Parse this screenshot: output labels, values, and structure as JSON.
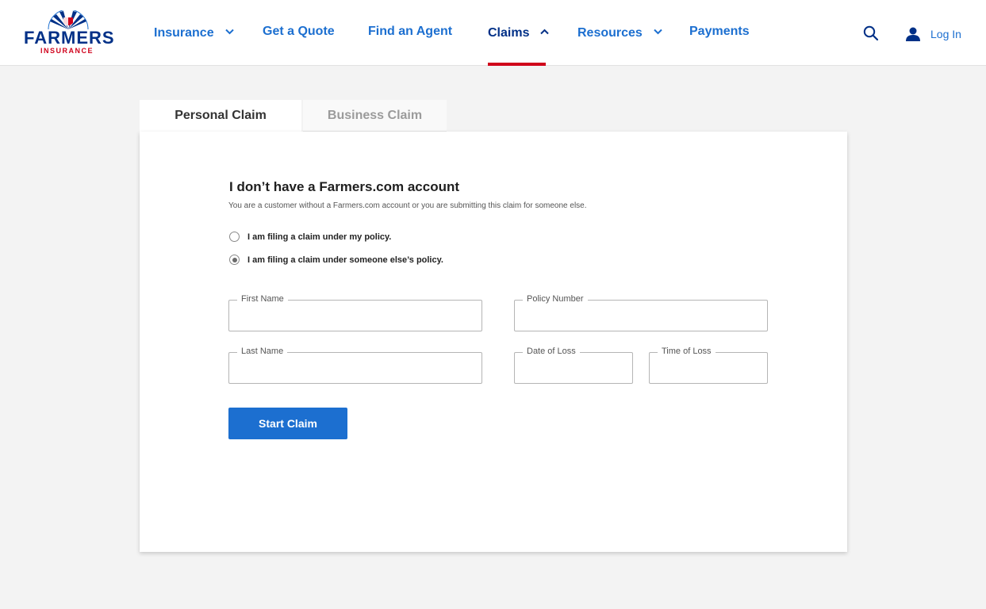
{
  "brand": {
    "logo_word": "FARMERS",
    "logo_sub": "INSURANCE",
    "primary_color": "#003087",
    "accent_red": "#d0021b",
    "link_blue": "#1c6fd0"
  },
  "nav": {
    "items": [
      {
        "label": "Insurance",
        "has_dropdown": true,
        "expanded": false
      },
      {
        "label": "Get a Quote",
        "has_dropdown": false
      },
      {
        "label": "Find an Agent",
        "has_dropdown": false
      },
      {
        "label": "Claims",
        "has_dropdown": true,
        "expanded": true,
        "active": true
      },
      {
        "label": "Resources",
        "has_dropdown": true,
        "expanded": false
      },
      {
        "label": "Payments",
        "has_dropdown": false
      }
    ],
    "search_icon": "search-icon",
    "login_icon": "user-icon",
    "login_label": "Log In"
  },
  "tabs": [
    {
      "label": "Personal Claim",
      "selected": true
    },
    {
      "label": "Business Claim",
      "selected": false
    }
  ],
  "form": {
    "title": "I don’t have a Farmers.com account",
    "subtitle": "You are a customer without a Farmers.com account or you are submitting this claim for someone else.",
    "options": [
      {
        "label": "I am filing a claim under my policy.",
        "checked": false
      },
      {
        "label": "I am filing a claim under someone else’s policy.",
        "checked": true
      }
    ],
    "fields": {
      "first_name": {
        "label": "First Name",
        "value": ""
      },
      "policy_number": {
        "label": "Policy Number",
        "value": ""
      },
      "last_name": {
        "label": "Last Name",
        "value": ""
      },
      "date_of_loss": {
        "label": "Date of Loss",
        "value": ""
      },
      "time_of_loss": {
        "label": "Time of Loss",
        "value": ""
      }
    },
    "submit_label": "Start Claim"
  }
}
